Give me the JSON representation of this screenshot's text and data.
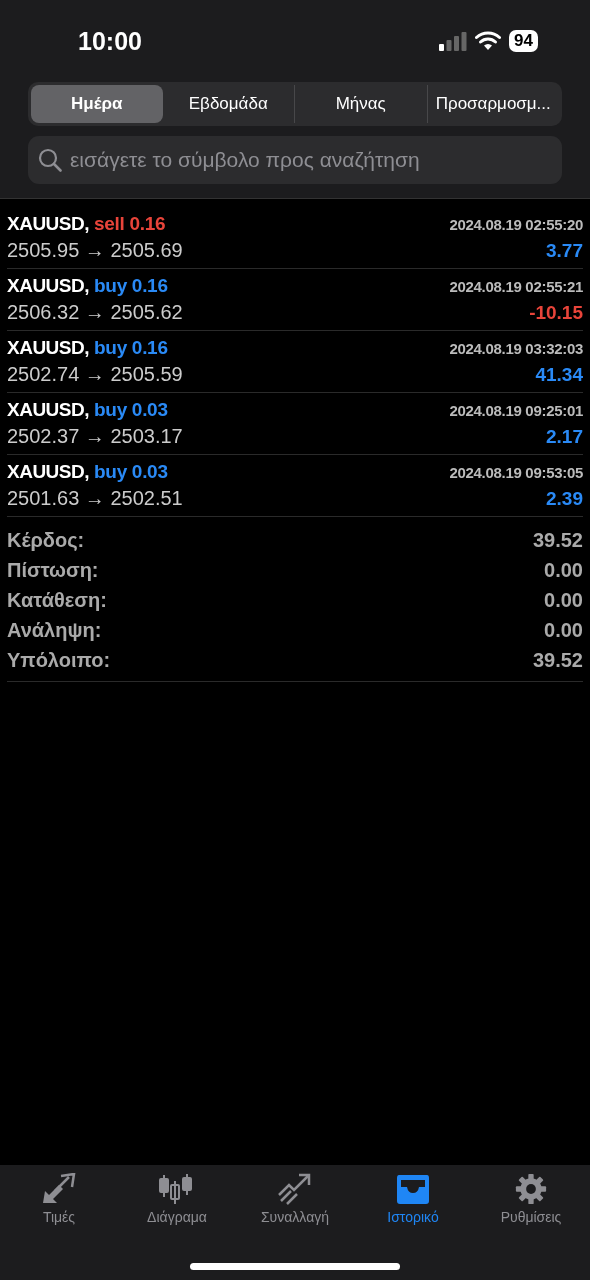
{
  "status_bar": {
    "time": "10:00",
    "battery": "94"
  },
  "period_tabs": [
    {
      "label": "Ημέρα",
      "selected": true
    },
    {
      "label": "Εβδομάδα",
      "selected": false
    },
    {
      "label": "Μήνας",
      "selected": false
    },
    {
      "label": "Προσαρμοσμ...",
      "selected": false
    }
  ],
  "search": {
    "placeholder": "εισάγετε το σύμβολο προς αναζήτηση"
  },
  "trades": [
    {
      "symbol": "XAUUSD,",
      "kind": "sell",
      "order": "sell 0.16",
      "time": "2024.08.19 02:55:20",
      "prices": "2505.95 → 2505.69",
      "profit": {
        "value": "3.77",
        "color": "#2a8af6"
      }
    },
    {
      "symbol": "XAUUSD,",
      "kind": "buy",
      "order": "buy 0.16",
      "time": "2024.08.19 02:55:21",
      "prices": "2506.32 → 2505.62",
      "profit": {
        "value": "-10.15",
        "color": "#e8443a"
      }
    },
    {
      "symbol": "XAUUSD,",
      "kind": "buy",
      "order": "buy 0.16",
      "time": "2024.08.19 03:32:03",
      "prices": "2502.74 → 2505.59",
      "profit": {
        "value": "41.34",
        "color": "#2a8af6"
      }
    },
    {
      "symbol": "XAUUSD,",
      "kind": "buy",
      "order": "buy 0.03",
      "time": "2024.08.19 09:25:01",
      "prices": "2502.37 → 2503.17",
      "profit": {
        "value": "2.17",
        "color": "#2a8af6"
      }
    },
    {
      "symbol": "XAUUSD,",
      "kind": "buy",
      "order": "buy 0.03",
      "time": "2024.08.19 09:53:05",
      "prices": "2501.63 → 2502.51",
      "profit": {
        "value": "2.39",
        "color": "#2a8af6"
      }
    }
  ],
  "summary": [
    {
      "label": "Κέρδος:",
      "value": "39.52"
    },
    {
      "label": "Πίστωση:",
      "value": "0.00"
    },
    {
      "label": "Κατάθεση:",
      "value": "0.00"
    },
    {
      "label": "Ανάληψη:",
      "value": "0.00"
    },
    {
      "label": "Υπόλοιπο:",
      "value": "39.52"
    }
  ],
  "tab_bar": [
    {
      "kind": "quotes",
      "label": "Τιμές",
      "selected": false
    },
    {
      "kind": "chart",
      "label": "Διάγραμα",
      "selected": false
    },
    {
      "kind": "trade",
      "label": "Συναλλαγή",
      "selected": false
    },
    {
      "kind": "history",
      "label": "Ιστορικό",
      "selected": true
    },
    {
      "kind": "settings",
      "label": "Ρυθμίσεις",
      "selected": false
    }
  ]
}
